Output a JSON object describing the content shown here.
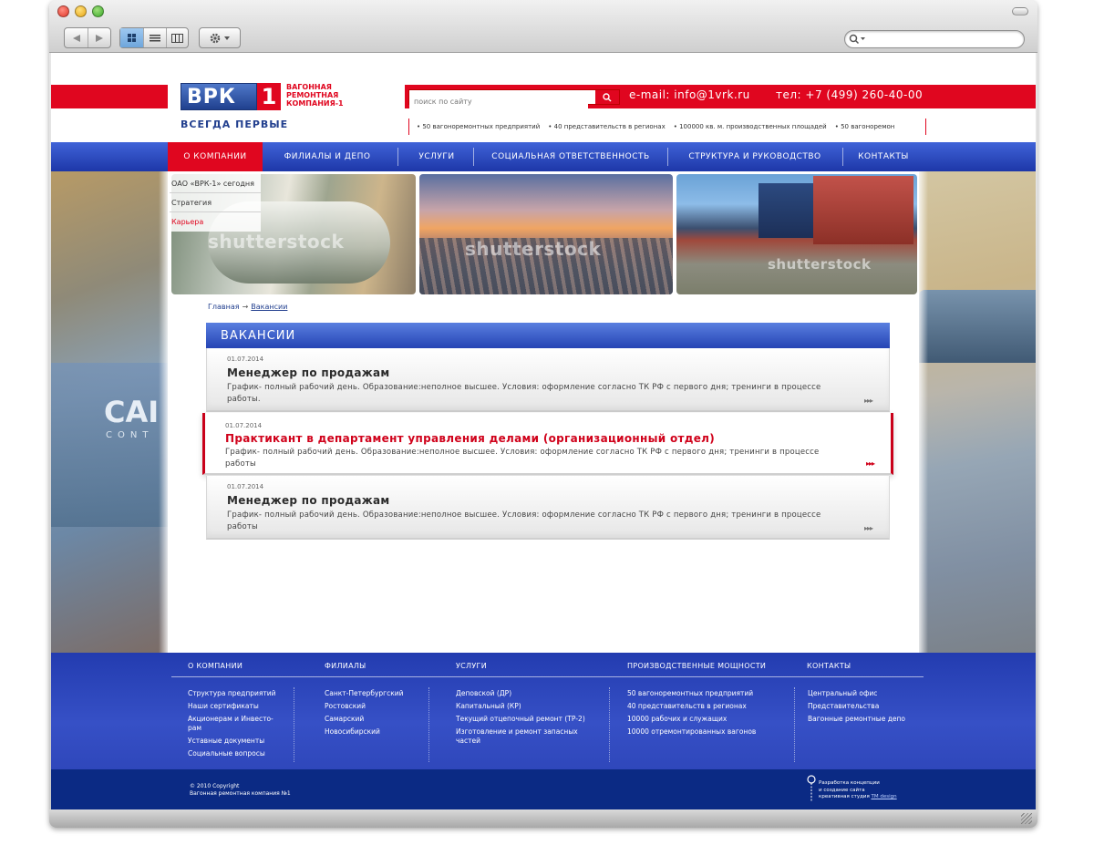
{
  "browser": {
    "toolbar": {
      "back_icon": "back-arrow-icon",
      "forward_icon": "forward-arrow-icon",
      "view_modes": [
        "icon-view-icon",
        "list-view-icon",
        "column-view-icon"
      ],
      "action_icon": "gear-icon",
      "search_placeholder": ""
    }
  },
  "site": {
    "logo": {
      "mark": "ВРК",
      "number": "1",
      "text_line1": "ВАГОННАЯ",
      "text_line2": "РЕМОНТНАЯ",
      "text_line3": "КОМПАНИЯ-1"
    },
    "slogan": "ВСЕГДА ПЕРВЫЕ",
    "search_placeholder": "поиск по сайту",
    "email": "e-mail: info@1vrk.ru",
    "phone": "тел: +7 (499) 260-40-00",
    "ticker": [
      "• 50 вагоноремонтных предприятий",
      "• 40 представительств в регионах",
      "• 100000 кв. м. производственных площадей",
      "• 50 вагоноремон"
    ],
    "brand_color": "#e0061f",
    "accent_color": "#2544b4"
  },
  "nav": {
    "items": [
      "О КОМПАНИИ",
      "ФИЛИАЛЫ И ДЕПО",
      "УСЛУГИ",
      "СОЦИАЛЬНАЯ ОТВЕТСТВЕННОСТЬ",
      "СТРУКТУРА И РУКОВОДСТВО",
      "КОНТАКТЫ"
    ],
    "active_index": 0
  },
  "submenu": {
    "items": [
      "ОАО «ВРК-1» сегодня",
      "Стратегия",
      "Карьера"
    ],
    "current_index": 2
  },
  "banners": {
    "watermark": "shutterstock"
  },
  "background": {
    "left_caption": "CAI",
    "left_caption2": "CONT"
  },
  "breadcrumb": {
    "home": "Главная",
    "separator": "→",
    "current": "Вакансии"
  },
  "vacancies": {
    "title": "ВАКАНСИИ",
    "items": [
      {
        "date": "01.07.2014",
        "title": "Менеджер по продажам",
        "text": "График- полный рабочий день. Образование:неполное высшее. Условия: оформление согласно ТК РФ с первого дня; тренинги в процессе работы.",
        "more": "▸▸▸"
      },
      {
        "date": "01.07.2014",
        "title": "Практикант в департамент управления делами (организационный отдел)",
        "text": "График- полный рабочий день. Образование:неполное высшее. Условия: оформление согласно ТК РФ с первого дня; тренинги в процессе работы",
        "more": "▸▸▸"
      },
      {
        "date": "01.07.2014",
        "title": "Менеджер по продажам",
        "text": "График- полный рабочий день. Образование:неполное высшее. Условия: оформление согласно ТК РФ с первого дня; тренинги в процессе работы",
        "more": "▸▸▸"
      }
    ]
  },
  "footer": {
    "columns": [
      {
        "heading": "О КОМПАНИИ",
        "links": [
          "Структура предприятий",
          "Наши сертификаты",
          "Акционерам и Инвесто-рам",
          "Уставные документы",
          "Социальные вопросы"
        ]
      },
      {
        "heading": "ФИЛИАЛЫ",
        "links": [
          "Санкт-Петербургский",
          "Ростовский",
          "Самарский",
          "Новосибирский"
        ]
      },
      {
        "heading": "УСЛУГИ",
        "links": [
          "Деповской (ДР)",
          "Капитальный (КР)",
          "Текущий отцепочный ремонт (ТР-2)",
          "Изготовление и ремонт запасных частей"
        ]
      },
      {
        "heading": "ПРОИЗВОДСТВЕННЫЕ МОЩНОСТИ",
        "links": [
          "50 вагоноремонтных предприятий",
          "40 представительств в регионах",
          "10000 рабочих и служащих",
          "10000 отремонтированных вагонов"
        ]
      },
      {
        "heading": "КОНТАКТЫ",
        "links": [
          "Центральный офис",
          "Представительства",
          "Вагонные ремонтные депо"
        ]
      }
    ],
    "copyright_line1": "© 2010 Copyright",
    "copyright_line2": "Вагонная ремонтная компания №1",
    "developer_line1": "Разработка концепции",
    "developer_line2": "и создание сайта",
    "developer_line3": "креативная студия",
    "developer_link": "TM design"
  }
}
